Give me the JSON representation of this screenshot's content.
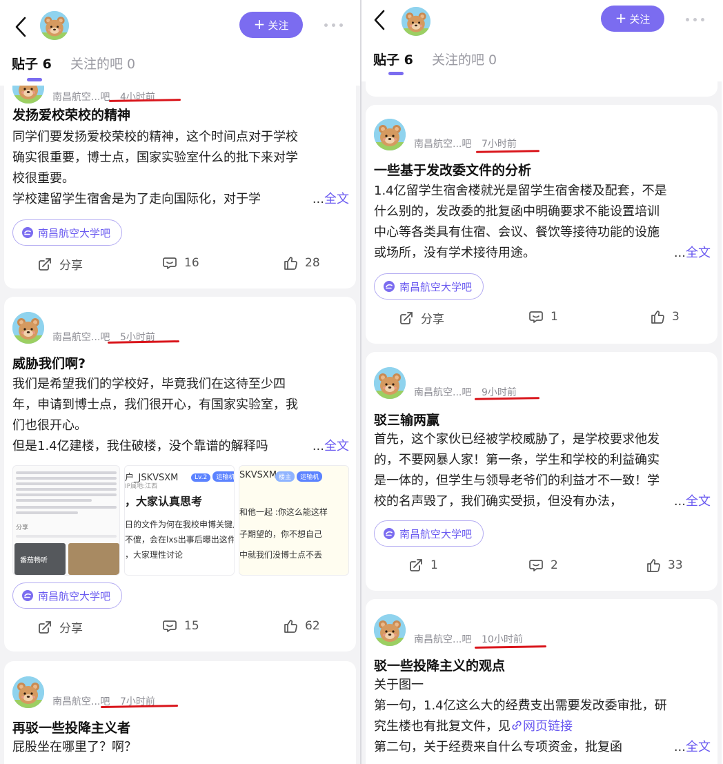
{
  "left": {
    "header": {
      "follow_label": "关注",
      "tab_posts": "贴子 6",
      "tab_follow": "关注的吧 0"
    },
    "posts": [
      {
        "bar": "南昌航空...吧",
        "time": "4小时前",
        "title": "发扬爱校荣校的精神",
        "lines": [
          "同学们要发扬爱校荣校的精神，这个时间点对于学校",
          "确实很重要，博士点，国家实验室什么的批下来对学",
          "校很重要。"
        ],
        "last": "学校建留学生宿舍是为了走向国际化，对于学",
        "ellipsis": "...",
        "more": "全文",
        "chip": "南昌航空大学吧",
        "share": "分享",
        "comments": "16",
        "likes": "28"
      },
      {
        "bar": "南昌航空...吧",
        "time": "5小时前",
        "title": "威胁我们啊?",
        "lines": [
          "我们是希望我们的学校好，毕竟我们在这待至少四",
          "年，申请到博士点，我们很开心，有国家实验室，我",
          "们也很开心。"
        ],
        "last": "但是1.4亿建楼，我住破楼，没个靠谱的解释吗",
        "ellipsis": "...",
        "more": "全文",
        "chip": "南昌航空大学吧",
        "share": "分享",
        "comments": "15",
        "likes": "62",
        "thumb1": {
          "cap1": "番茄畅听",
          "cap2": "分享"
        },
        "thumb2": {
          "user": "户_JSKVSXM",
          "level": "Lv.2",
          "tag": "运输机",
          "ip": "IP属地:江西",
          "headline": "，大家认真思考",
          "l1": "日的文件为何在我校申博关键点",
          "l2": "不傻，会在lxs出事后曝出这件事，",
          "l3": "，大家理性讨论"
        },
        "thumb3": {
          "user": "SKVSXM",
          "tag1": "楼主",
          "tag2": "运输机",
          "l1": "和他一起  :你这么能这样",
          "l2": "子期望的，你不想自己",
          "l3": "中就我们没博士点不丢"
        }
      },
      {
        "bar": "南昌航空...吧",
        "time": "7小时前",
        "title": "再驳一些投降主义者",
        "lines": [
          "屁股坐在哪里了？啊？"
        ]
      }
    ]
  },
  "right": {
    "header": {
      "follow_label": "关注",
      "tab_posts": "贴子 6",
      "tab_follow": "关注的吧 0"
    },
    "posts": [
      {
        "bar": "南昌航空...吧",
        "time": "7小时前",
        "title": "一些基于发改委文件的分析",
        "lines": [
          "1.4亿留学生宿舍楼就光是留学生宿舍楼及配套，不是",
          "什么别的，发改委的批复函中明确要求不能设置培训",
          "中心等各类具有住宿、会议、餐饮等接待功能的设施"
        ],
        "last": "或场所，没有学术接待用途。",
        "ellipsis": "...",
        "more": "全文",
        "chip": "南昌航空大学吧",
        "share": "分享",
        "comments": "1",
        "likes": "3"
      },
      {
        "bar": "南昌航空...吧",
        "time": "9小时前",
        "title": "驳三输两赢",
        "lines": [
          "首先，这个家伙已经被学校威胁了，是学校要求他发",
          "的，不要网暴人家！第一条，学生和学校的利益确实",
          "是一体的，但学生与领导老爷们的利益才不一致！学"
        ],
        "last": "校的名声毁了，我们确实受损，但没有办法，",
        "ellipsis": "...",
        "more": "全文",
        "chip": "南昌航空大学吧",
        "share": "1",
        "comments": "2",
        "likes": "33"
      },
      {
        "bar": "南昌航空...吧",
        "time": "10小时前",
        "title": "驳一些投降主义的观点",
        "lines": [
          "关于图一",
          "第一句，1.4亿这么大的经费支出需要发改委审批，研"
        ],
        "link_prefix": "究生楼也有批复文件，见",
        "link_text": "网页链接",
        "last": "第二句，关于经费来自什么专项资金，批复函",
        "ellipsis": "...",
        "more": "全文"
      }
    ]
  },
  "colors": {
    "accent": "#7b6cf0",
    "underline_red": "#d9151b",
    "text_gray": "#8e8e95"
  },
  "icons": [
    "back-icon",
    "bear-avatar",
    "more-icon",
    "share-icon",
    "comment-icon",
    "like-icon",
    "bar-icon",
    "link-icon"
  ]
}
